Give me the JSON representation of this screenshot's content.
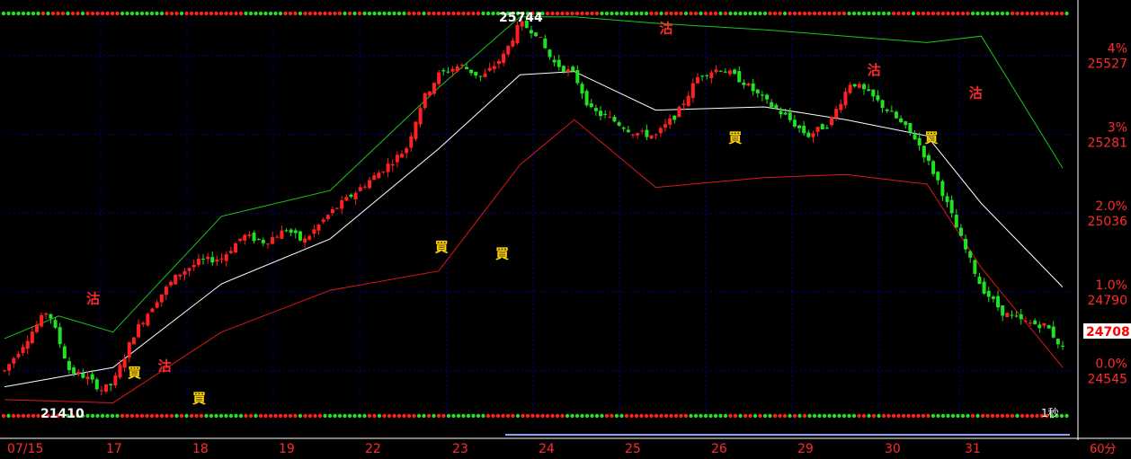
{
  "chart_data": {
    "type": "candlestick",
    "interval_label": "60分",
    "date_labels": [
      "07/15",
      "17",
      "18",
      "19",
      "22",
      "23",
      "24",
      "25",
      "26",
      "29",
      "30",
      "31"
    ],
    "right_axis": {
      "percent_ticks": [
        {
          "label": "4%",
          "price": 25620
        },
        {
          "label": "3%",
          "price": 25375
        },
        {
          "label": "2.0%",
          "price": 25130
        },
        {
          "label": "1.0%",
          "price": 24885
        },
        {
          "label": "0.0%",
          "price": 24640
        }
      ],
      "price_ticks": [
        25527,
        25281,
        25036,
        24790,
        24545
      ],
      "ylim": [
        24480,
        25770
      ]
    },
    "last_price": 24708,
    "high_marker": {
      "label": "25744",
      "value": 25744
    },
    "low_marker": {
      "label": "21410"
    },
    "corner_label": "1秒",
    "signals": [
      {
        "text": "沽",
        "color": "#ff2a2a",
        "date_index": 0.8,
        "price": 24850
      },
      {
        "text": "買",
        "color": "#ffd400",
        "date_index": 1.25,
        "price": 24620
      },
      {
        "text": "沽",
        "color": "#ff2a2a",
        "date_index": 1.6,
        "price": 24640
      },
      {
        "text": "買",
        "color": "#ffd400",
        "date_index": 2.0,
        "price": 24540
      },
      {
        "text": "買",
        "color": "#ffd400",
        "date_index": 4.8,
        "price": 25010
      },
      {
        "text": "買",
        "color": "#ffd400",
        "date_index": 5.5,
        "price": 24990
      },
      {
        "text": "沽",
        "color": "#ff2a2a",
        "date_index": 7.4,
        "price": 25690
      },
      {
        "text": "買",
        "color": "#ffd400",
        "date_index": 8.2,
        "price": 25350
      },
      {
        "text": "沽",
        "color": "#ff2a2a",
        "date_index": 9.8,
        "price": 25560
      },
      {
        "text": "買",
        "color": "#ffd400",
        "date_index": 10.5,
        "price": 25350
      },
      {
        "text": "沽",
        "color": "#ff2a2a",
        "date_index": 11.05,
        "price": 25490
      }
    ],
    "close_path": [
      [
        0.0,
        24640
      ],
      [
        0.5,
        24760
      ],
      [
        0.8,
        24830
      ],
      [
        1.2,
        24640
      ],
      [
        1.5,
        24620
      ],
      [
        1.8,
        24580
      ],
      [
        2.0,
        24600
      ],
      [
        2.4,
        24760
      ],
      [
        2.8,
        24860
      ],
      [
        3.2,
        24940
      ],
      [
        3.6,
        24980
      ],
      [
        4.0,
        24990
      ],
      [
        4.4,
        25060
      ],
      [
        4.8,
        25040
      ],
      [
        5.2,
        25080
      ],
      [
        5.5,
        25040
      ],
      [
        6.0,
        25130
      ],
      [
        6.5,
        25200
      ],
      [
        7.0,
        25270
      ],
      [
        7.4,
        25330
      ],
      [
        7.7,
        25480
      ],
      [
        8.0,
        25560
      ],
      [
        8.4,
        25590
      ],
      [
        8.8,
        25550
      ],
      [
        9.2,
        25620
      ],
      [
        9.5,
        25720
      ],
      [
        9.8,
        25690
      ],
      [
        10.1,
        25600
      ],
      [
        10.5,
        25560
      ],
      [
        10.8,
        25450
      ],
      [
        11.2,
        25420
      ],
      [
        11.6,
        25380
      ],
      [
        12.0,
        25370
      ],
      [
        12.4,
        25440
      ],
      [
        12.8,
        25560
      ],
      [
        13.2,
        25580
      ],
      [
        13.6,
        25540
      ],
      [
        14.0,
        25480
      ],
      [
        14.4,
        25430
      ],
      [
        14.8,
        25370
      ],
      [
        15.2,
        25410
      ],
      [
        15.6,
        25540
      ],
      [
        16.0,
        25490
      ],
      [
        16.4,
        25430
      ],
      [
        16.8,
        25360
      ],
      [
        17.2,
        25230
      ],
      [
        17.6,
        25060
      ],
      [
        18.0,
        24900
      ],
      [
        18.4,
        24820
      ],
      [
        18.8,
        24790
      ],
      [
        19.2,
        24780
      ],
      [
        19.5,
        24708
      ]
    ],
    "bollinger": {
      "middle_color": "#ffffff",
      "upper_color": "#19c819",
      "lower_color": "#e01818",
      "middle": [
        [
          0.0,
          24590
        ],
        [
          2.0,
          24650
        ],
        [
          4.0,
          24910
        ],
        [
          6.0,
          25050
        ],
        [
          8.0,
          25330
        ],
        [
          9.5,
          25560
        ],
        [
          10.5,
          25570
        ],
        [
          12.0,
          25450
        ],
        [
          14.0,
          25460
        ],
        [
          15.5,
          25420
        ],
        [
          17.0,
          25370
        ],
        [
          18.0,
          25160
        ],
        [
          19.5,
          24900
        ]
      ],
      "upper": [
        [
          0.0,
          24740
        ],
        [
          1.0,
          24810
        ],
        [
          2.0,
          24760
        ],
        [
          4.0,
          25120
        ],
        [
          6.0,
          25200
        ],
        [
          8.0,
          25520
        ],
        [
          9.5,
          25740
        ],
        [
          10.5,
          25740
        ],
        [
          12.0,
          25720
        ],
        [
          14.0,
          25700
        ],
        [
          15.5,
          25680
        ],
        [
          17.0,
          25660
        ],
        [
          18.0,
          25680
        ],
        [
          19.5,
          25270
        ]
      ],
      "lower": [
        [
          0.0,
          24550
        ],
        [
          2.0,
          24540
        ],
        [
          4.0,
          24760
        ],
        [
          6.0,
          24890
        ],
        [
          8.0,
          24950
        ],
        [
          9.5,
          25280
        ],
        [
          10.5,
          25420
        ],
        [
          12.0,
          25210
        ],
        [
          14.0,
          25240
        ],
        [
          15.5,
          25250
        ],
        [
          17.0,
          25220
        ],
        [
          18.0,
          24960
        ],
        [
          19.5,
          24650
        ]
      ]
    }
  },
  "colors": {
    "background": "#000000",
    "up_candle": "#ff2020",
    "down_candle": "#22e022",
    "grid": "#0000a0",
    "axis_text_red": "#ff2a2a",
    "label_yellow": "#ffd400",
    "last_price_box": "#ffffff"
  }
}
